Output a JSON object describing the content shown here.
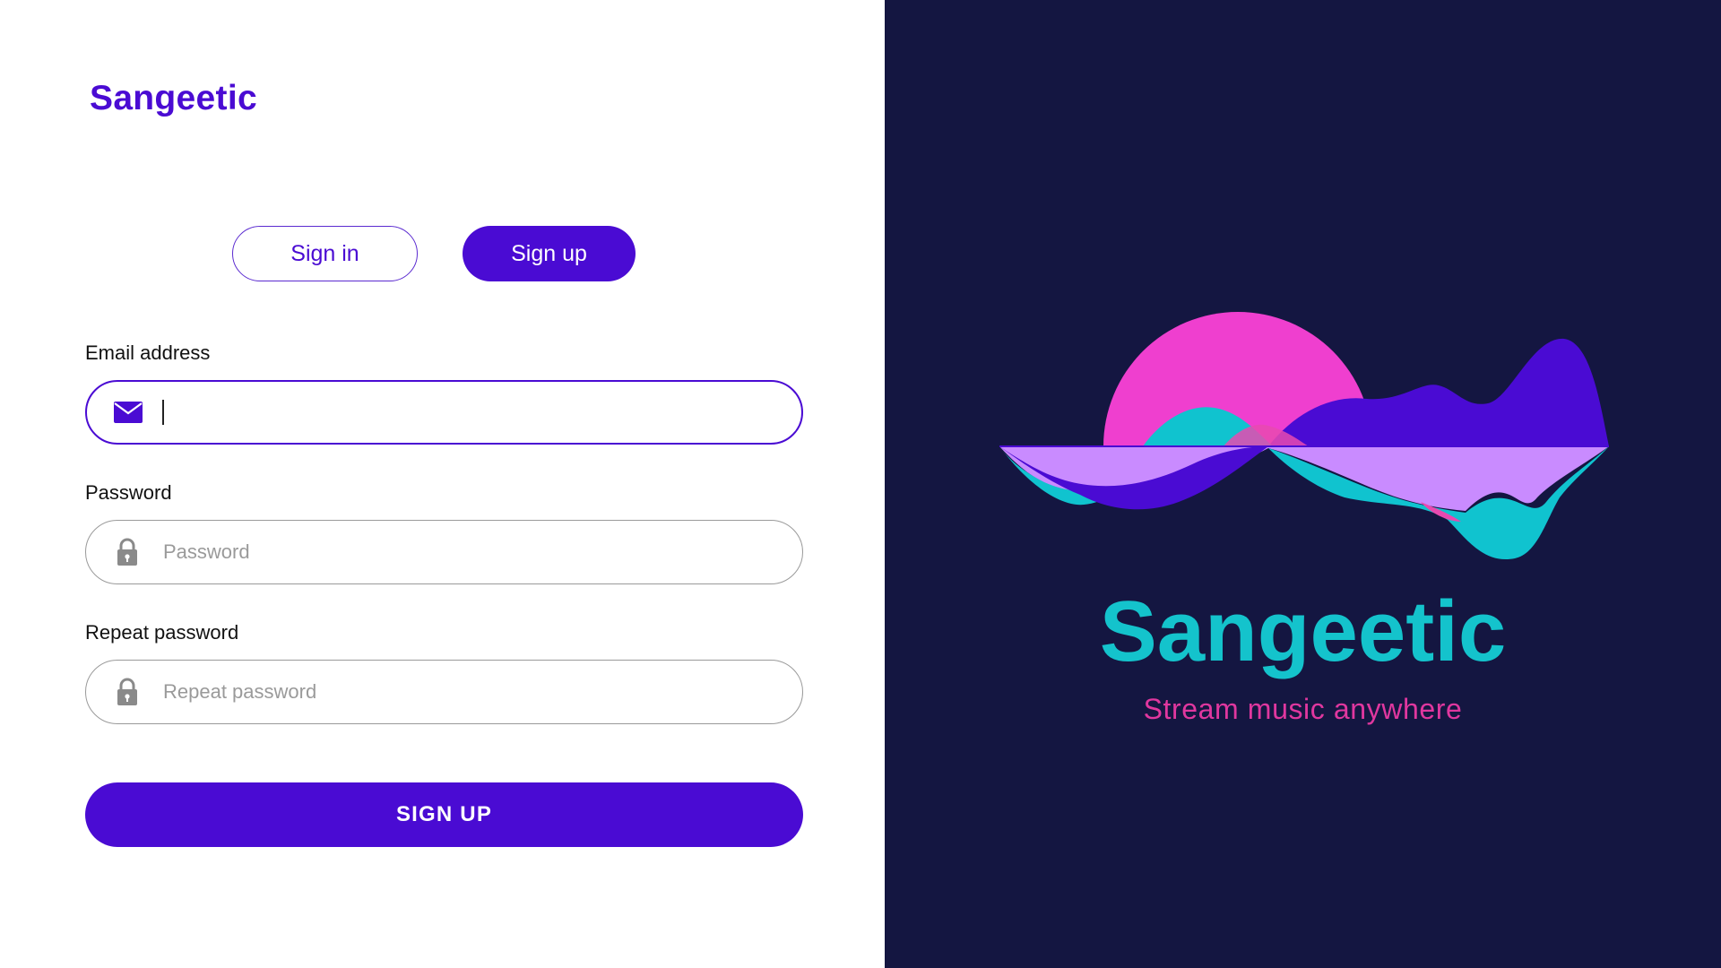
{
  "brand": {
    "name": "Sangeetic"
  },
  "tabs": [
    {
      "label": "Sign in",
      "active": false
    },
    {
      "label": "Sign up",
      "active": true
    }
  ],
  "form": {
    "email": {
      "label": "Email address",
      "value": "",
      "placeholder": "",
      "icon": "envelope-icon"
    },
    "password": {
      "label": "Password",
      "value": "",
      "placeholder": "Password",
      "icon": "lock-icon"
    },
    "repeat_password": {
      "label": "Repeat password",
      "value": "",
      "placeholder": "Repeat password",
      "icon": "lock-icon"
    },
    "submit_label": "SIGN UP"
  },
  "hero": {
    "title": "Sangeetic",
    "tagline": "Stream music anywhere"
  },
  "colors": {
    "accent": "#4a0bd3",
    "panel_bg": "#141641",
    "teal": "#14c3cc",
    "pink": "#e0379f",
    "magenta": "#ef3fcf",
    "lavender": "#c98bff"
  }
}
